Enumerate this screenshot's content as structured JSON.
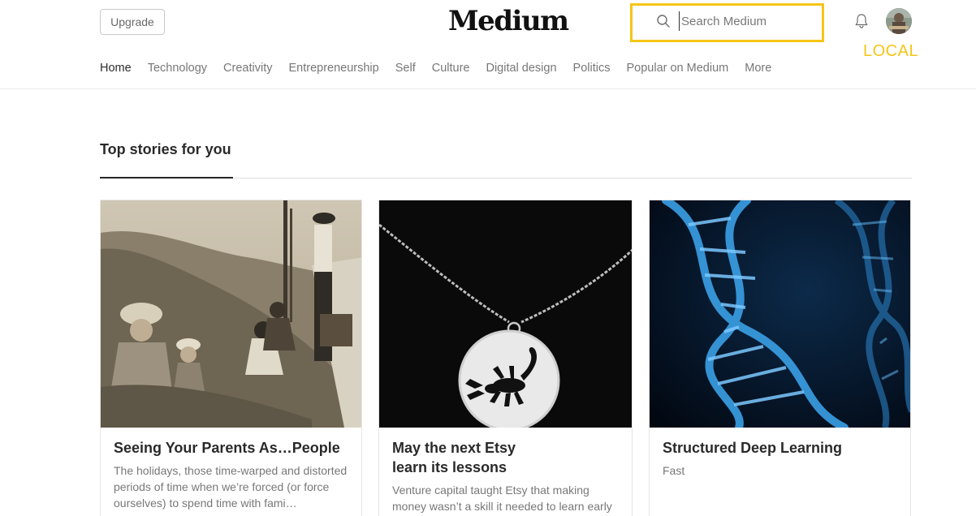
{
  "header": {
    "upgrade_label": "Upgrade",
    "logo_text": "Medium",
    "search_placeholder": "Search Medium",
    "annotation_label": "LOCAL"
  },
  "icons": {
    "search": "search-icon",
    "bell": "bell-icon",
    "avatar": "avatar"
  },
  "nav": {
    "items": [
      {
        "label": "Home",
        "active": true
      },
      {
        "label": "Technology"
      },
      {
        "label": "Creativity"
      },
      {
        "label": "Entrepreneurship"
      },
      {
        "label": "Self"
      },
      {
        "label": "Culture"
      },
      {
        "label": "Digital design"
      },
      {
        "label": "Politics"
      },
      {
        "label": "Popular on Medium"
      },
      {
        "label": "More"
      }
    ]
  },
  "section": {
    "title": "Top stories for you"
  },
  "stories": [
    {
      "title": "Seeing Your Parents As…People",
      "description": "The holidays, those time-warped and distorted periods of time when we’re forced (or force ourselves) to spend time with fami…"
    },
    {
      "title": "May the next Etsy learn its lessons",
      "description": "Venture capital taught Etsy that making money wasn’t a skill it needed to learn early"
    },
    {
      "title": "Structured Deep Learning",
      "description": "Fast"
    }
  ],
  "colors": {
    "highlight": "#f5c518",
    "text_primary": "rgba(0,0,0,0.84)",
    "text_secondary": "rgba(0,0,0,0.54)"
  }
}
